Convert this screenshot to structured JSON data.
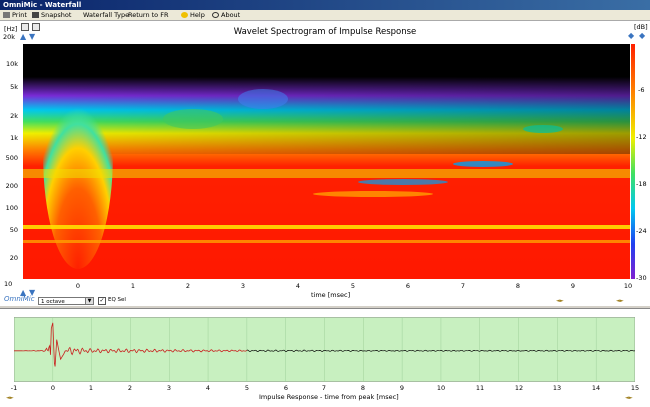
{
  "window": {
    "title": "OmniMic - Waterfall"
  },
  "menu": {
    "print": "Print",
    "snapshot": "Snapshot",
    "waterfall_type": "Waterfall Type",
    "return_to_fr": "Return to FR",
    "help": "Help",
    "about": "About"
  },
  "spectrogram": {
    "title": "Wavelet Spectrogram of Impulse Response",
    "y_units": "[Hz]",
    "y_top": "20k",
    "y_ticks": [
      "10k",
      "5k",
      "2k",
      "1k",
      "500",
      "200",
      "100",
      "50",
      "20"
    ],
    "y_bottom": "10",
    "x_ticks": [
      "0",
      "1",
      "2",
      "3",
      "4",
      "5",
      "6",
      "7",
      "8",
      "9",
      "10"
    ],
    "xlabel": "time [msec]",
    "scale_units": "[dB]",
    "scale_ticks": [
      "-6",
      "-12",
      "-18",
      "-24",
      "-30"
    ]
  },
  "controls": {
    "logo": "OmniMic",
    "smoothing": "1 octave",
    "eq_label": "EQ Sel"
  },
  "chart_data": [
    {
      "type": "heatmap",
      "title": "Wavelet Spectrogram of Impulse Response",
      "xlabel": "time [msec]",
      "ylabel": "[Hz]",
      "xlim": [
        -1,
        10
      ],
      "ylim": [
        10,
        20000
      ],
      "yscale": "log",
      "colorbar": {
        "label": "[dB]",
        "range": [
          -30,
          0
        ],
        "ticks": [
          -6,
          -12,
          -18,
          -24,
          -30
        ]
      }
    },
    {
      "type": "line",
      "title": "",
      "xlabel": "Impulse Response  - time from peak [msec]",
      "xlim": [
        -1,
        15
      ],
      "x_ticks": [
        "-1",
        "0",
        "1",
        "2",
        "3",
        "4",
        "5",
        "6",
        "7",
        "8",
        "9",
        "10",
        "11",
        "12",
        "13",
        "14",
        "15"
      ],
      "series": [
        {
          "x": [
            -1,
            -0.2,
            0,
            0.05,
            0.1,
            0.2,
            0.4,
            1,
            2,
            3,
            4,
            5,
            6,
            8,
            10,
            12,
            14,
            15
          ],
          "values": [
            0,
            -0.02,
            1,
            -0.8,
            0.4,
            -0.3,
            0.15,
            0.08,
            0.07,
            0.05,
            0.04,
            0.03,
            0.03,
            0.02,
            0.02,
            0.02,
            0.02,
            0.02
          ]
        }
      ]
    }
  ],
  "impulse": {
    "xlabel": "Impulse Response  - time from peak [msec]",
    "x_ticks": [
      "-1",
      "0",
      "1",
      "2",
      "3",
      "4",
      "5",
      "6",
      "7",
      "8",
      "9",
      "10",
      "11",
      "12",
      "13",
      "14",
      "15"
    ]
  },
  "colors": {
    "plot_bg": "#c8f0c0",
    "trace_red": "#c8201e",
    "trace_black": "#000000"
  }
}
